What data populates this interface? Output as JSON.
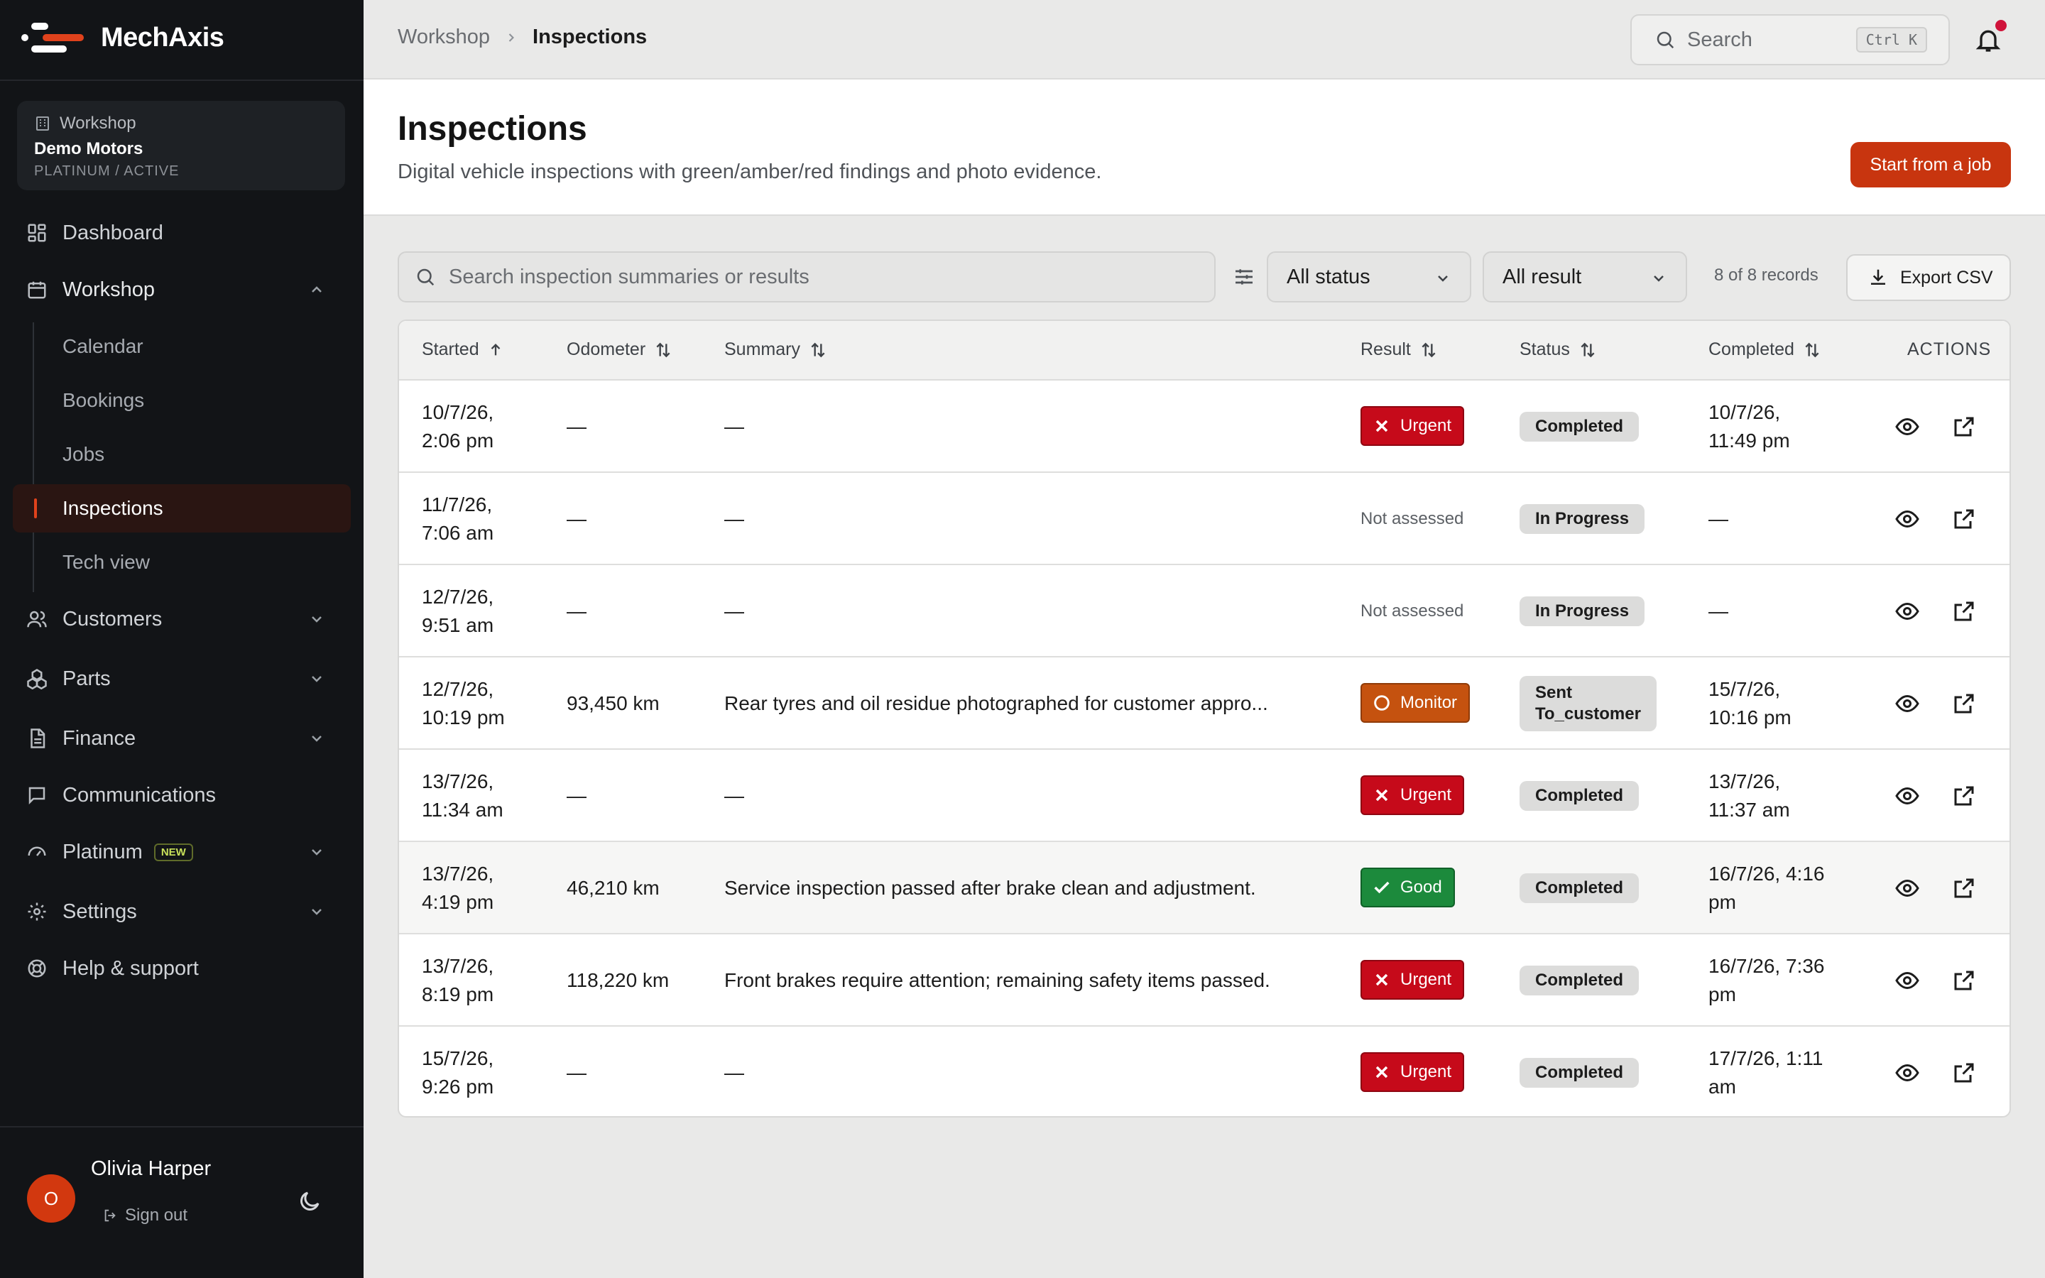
{
  "app": {
    "name": "MechAxis",
    "brand_color": "#c8350f"
  },
  "workspace": {
    "label": "Workshop",
    "name": "Demo Motors",
    "tier": "PLATINUM / ACTIVE"
  },
  "nav": {
    "dashboard": "Dashboard",
    "workshop": "Workshop",
    "workshop_sub": [
      "Calendar",
      "Bookings",
      "Jobs",
      "Inspections",
      "Tech view"
    ],
    "customers": "Customers",
    "parts": "Parts",
    "finance": "Finance",
    "communications": "Communications",
    "platinum": "Platinum",
    "platinum_badge": "NEW",
    "settings": "Settings",
    "help": "Help & support"
  },
  "user": {
    "initial": "O",
    "name": "Olivia Harper",
    "signout": "Sign out"
  },
  "breadcrumb": {
    "parent": "Workshop",
    "current": "Inspections"
  },
  "search": {
    "placeholder": "Search",
    "shortcut": "Ctrl K"
  },
  "page": {
    "title": "Inspections",
    "subtitle": "Digital vehicle inspections with green/amber/red findings and photo evidence.",
    "primary_action": "Start from a job"
  },
  "filters": {
    "search_placeholder": "Search inspection summaries or results",
    "status": "All status",
    "result": "All result",
    "records": "8 of 8 records",
    "export": "Export CSV"
  },
  "table": {
    "columns": {
      "started": "Started",
      "odometer": "Odometer",
      "summary": "Summary",
      "result": "Result",
      "status": "Status",
      "completed": "Completed",
      "actions": "ACTIONS"
    },
    "rows": [
      {
        "started": [
          "10/7/26,",
          "2:06 pm"
        ],
        "odometer": "—",
        "summary": "—",
        "result": "Urgent",
        "status": [
          "Completed"
        ],
        "completed": [
          "10/7/26,",
          "11:49 pm"
        ]
      },
      {
        "started": [
          "11/7/26,",
          "7:06 am"
        ],
        "odometer": "—",
        "summary": "—",
        "result": "Not assessed",
        "status": [
          "In Progress"
        ],
        "completed": [
          "—"
        ]
      },
      {
        "started": [
          "12/7/26,",
          "9:51 am"
        ],
        "odometer": "—",
        "summary": "—",
        "result": "Not assessed",
        "status": [
          "In Progress"
        ],
        "completed": [
          "—"
        ]
      },
      {
        "started": [
          "12/7/26,",
          "10:19 pm"
        ],
        "odometer": "93,450 km",
        "summary": "Rear tyres and oil residue photographed for customer appro...",
        "result": "Monitor",
        "status": [
          "Sent",
          "To_customer"
        ],
        "completed": [
          "15/7/26,",
          "10:16 pm"
        ]
      },
      {
        "started": [
          "13/7/26,",
          "11:34 am"
        ],
        "odometer": "—",
        "summary": "—",
        "result": "Urgent",
        "status": [
          "Completed"
        ],
        "completed": [
          "13/7/26,",
          "11:37 am"
        ]
      },
      {
        "started": [
          "13/7/26,",
          "4:19 pm"
        ],
        "odometer": "46,210 km",
        "summary": "Service inspection passed after brake clean and adjustment.",
        "result": "Good",
        "status": [
          "Completed"
        ],
        "completed": [
          "16/7/26, 4:16",
          "pm"
        ]
      },
      {
        "started": [
          "13/7/26,",
          "8:19 pm"
        ],
        "odometer": "118,220 km",
        "summary": "Front brakes require attention; remaining safety items passed.",
        "result": "Urgent",
        "status": [
          "Completed"
        ],
        "completed": [
          "16/7/26, 7:36",
          "pm"
        ]
      },
      {
        "started": [
          "15/7/26,",
          "9:26 pm"
        ],
        "odometer": "—",
        "summary": "—",
        "result": "Urgent",
        "status": [
          "Completed"
        ],
        "completed": [
          "17/7/26, 1:11",
          "am"
        ]
      }
    ]
  },
  "colors": {
    "urgent": "#c60a1a",
    "monitor": "#c5520f",
    "good": "#1c8a3c",
    "sidebar": "#121417"
  }
}
